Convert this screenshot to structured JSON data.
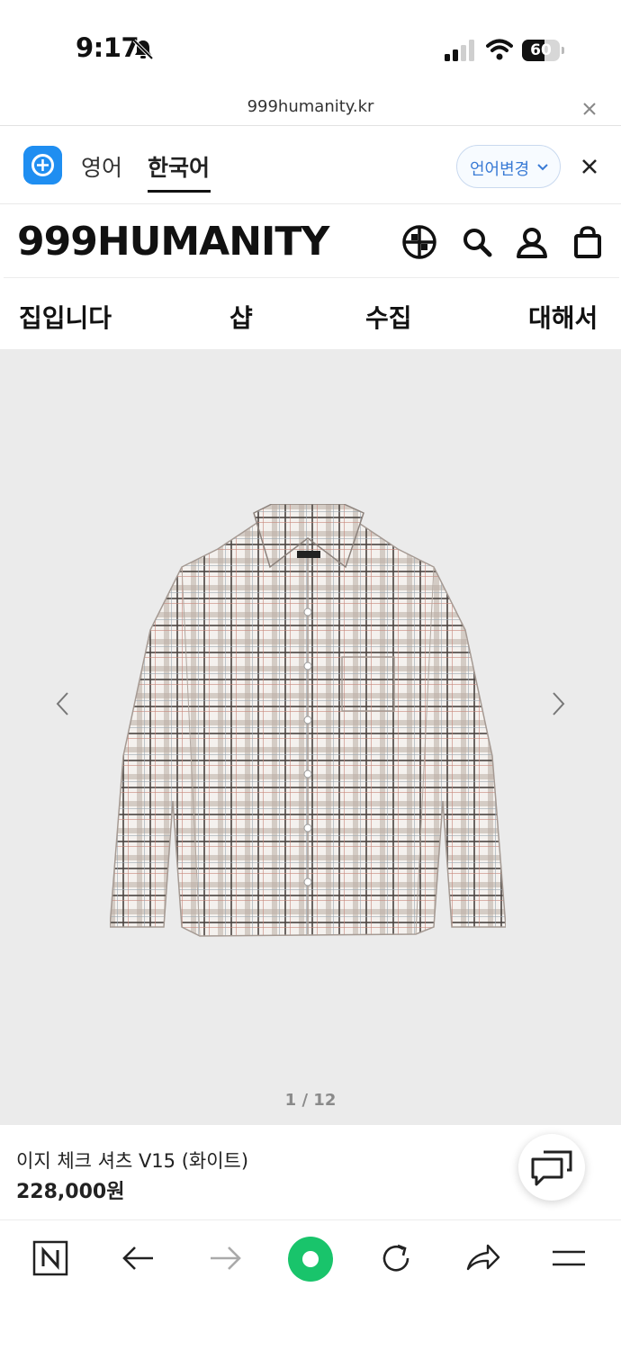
{
  "status_bar": {
    "time": "9:17",
    "battery": "60",
    "battery_level": 0.6
  },
  "url_bar": {
    "url": "999humanity.kr"
  },
  "translate_bar": {
    "source_language": "영어",
    "target_language": "한국어",
    "change_language_label": "언어변경",
    "active_tab": "한국어"
  },
  "header": {
    "logo": "999HUMANITY",
    "icons": [
      "globe-grid-icon",
      "search-icon",
      "account-icon",
      "shopping-bag-icon"
    ]
  },
  "nav": {
    "items": [
      "집입니다",
      "샵",
      "수집",
      "대해서"
    ]
  },
  "gallery": {
    "counter": "1 / 12",
    "image": "plaid-shirt-image"
  },
  "product": {
    "name": "이지 체크 셔츠 V15 (화이트)",
    "price": "228,000원"
  },
  "browser_toolbar": {
    "icons": [
      "naver-n-icon",
      "back-arrow-icon",
      "forward-arrow-icon",
      "green-home-button",
      "reload-icon",
      "share-icon",
      "menu-icon"
    ]
  },
  "colors": {
    "accent_blue": "#1f8ef1",
    "green_button": "#19c46b",
    "gallery_background": "#ebebeb"
  }
}
